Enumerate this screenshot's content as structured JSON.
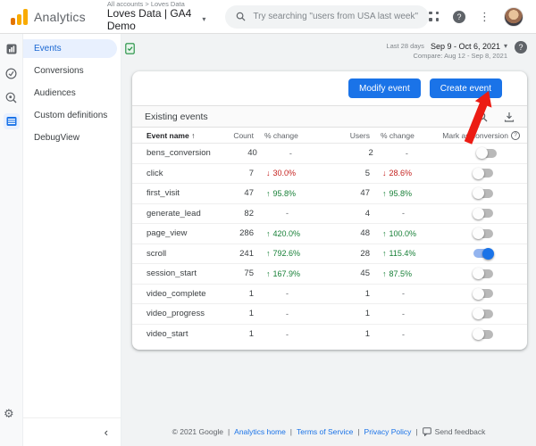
{
  "header": {
    "app_name": "Analytics",
    "breadcrumb": "All accounts > Loves Data",
    "property_selector": "Loves Data | GA4 Demo",
    "search_placeholder": "Try searching \"users from USA last week\""
  },
  "sidebar": {
    "items": [
      {
        "label": "Events",
        "selected": true
      },
      {
        "label": "Conversions",
        "selected": false
      },
      {
        "label": "Audiences",
        "selected": false
      },
      {
        "label": "Custom definitions",
        "selected": false
      },
      {
        "label": "DebugView",
        "selected": false
      }
    ]
  },
  "toolbar": {
    "date_preset": "Last 28 days",
    "date_range": "Sep 9 - Oct 6, 2021",
    "compare": "Compare: Aug 12 - Sep 8, 2021",
    "modify_label": "Modify event",
    "create_label": "Create event"
  },
  "table": {
    "title": "Existing events",
    "columns": [
      "Event name",
      "Count",
      "% change",
      "Users",
      "% change",
      "Mark as conversion"
    ],
    "rows": [
      {
        "name": "bens_conversion",
        "count": "40",
        "count_change": "-",
        "count_dir": "none",
        "users": "2",
        "users_change": "-",
        "users_dir": "none",
        "conversion": false
      },
      {
        "name": "click",
        "count": "7",
        "count_change": "30.0%",
        "count_dir": "down",
        "users": "5",
        "users_change": "28.6%",
        "users_dir": "down",
        "conversion": false
      },
      {
        "name": "first_visit",
        "count": "47",
        "count_change": "95.8%",
        "count_dir": "up",
        "users": "47",
        "users_change": "95.8%",
        "users_dir": "up",
        "conversion": false
      },
      {
        "name": "generate_lead",
        "count": "82",
        "count_change": "-",
        "count_dir": "none",
        "users": "4",
        "users_change": "-",
        "users_dir": "none",
        "conversion": false
      },
      {
        "name": "page_view",
        "count": "286",
        "count_change": "420.0%",
        "count_dir": "up",
        "users": "48",
        "users_change": "100.0%",
        "users_dir": "up",
        "conversion": false
      },
      {
        "name": "scroll",
        "count": "241",
        "count_change": "792.6%",
        "count_dir": "up",
        "users": "28",
        "users_change": "115.4%",
        "users_dir": "up",
        "conversion": true
      },
      {
        "name": "session_start",
        "count": "75",
        "count_change": "167.9%",
        "count_dir": "up",
        "users": "45",
        "users_change": "87.5%",
        "users_dir": "up",
        "conversion": false
      },
      {
        "name": "video_complete",
        "count": "1",
        "count_change": "-",
        "count_dir": "none",
        "users": "1",
        "users_change": "-",
        "users_dir": "none",
        "conversion": false
      },
      {
        "name": "video_progress",
        "count": "1",
        "count_change": "-",
        "count_dir": "none",
        "users": "1",
        "users_change": "-",
        "users_dir": "none",
        "conversion": false
      },
      {
        "name": "video_start",
        "count": "1",
        "count_change": "-",
        "count_dir": "none",
        "users": "1",
        "users_change": "-",
        "users_dir": "none",
        "conversion": false
      }
    ]
  },
  "footer": {
    "copyright": "© 2021 Google",
    "separator": "|",
    "links": [
      "Analytics home",
      "Terms of Service",
      "Privacy Policy"
    ],
    "feedback_label": "Send feedback"
  },
  "glyphs": {
    "up": "↑",
    "down": "↓",
    "caret": "▾",
    "sort_asc": "↑",
    "collapse": "‹",
    "help": "?",
    "overflow": "⋮",
    "question": "?"
  },
  "colors": {
    "accent_blue": "#1a73e8",
    "positive_green": "#188038",
    "negative_red": "#c5221f",
    "annotation_arrow_red": "#ec1c14",
    "selected_nav_bg": "#e8f0fe"
  }
}
